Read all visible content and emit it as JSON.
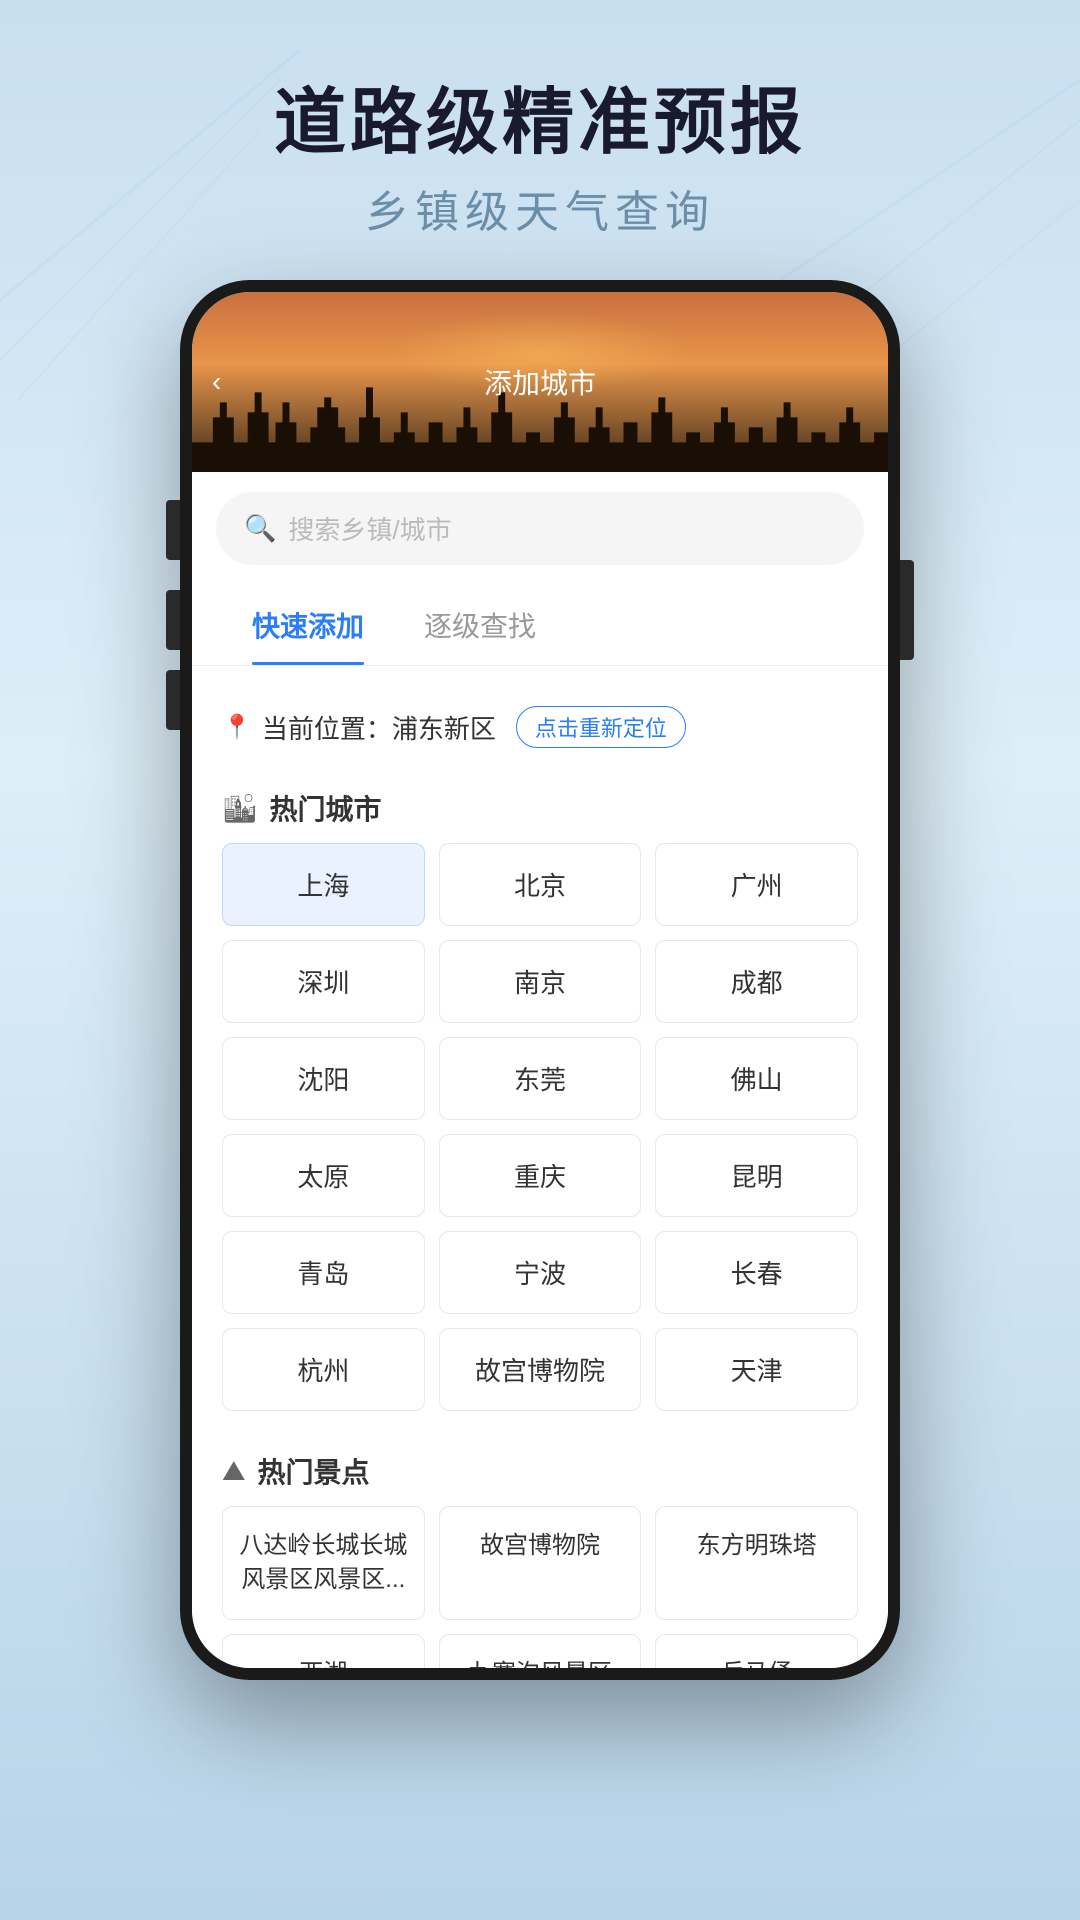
{
  "page": {
    "background": "#c8dff0"
  },
  "hero": {
    "title": "道路级精准预报",
    "subtitle": "乡镇级天气查询"
  },
  "app": {
    "header": {
      "back_label": "‹",
      "title": "添加城市"
    },
    "search": {
      "placeholder": "搜索乡镇/城市"
    },
    "tabs": [
      {
        "id": "quick",
        "label": "快速添加",
        "active": true
      },
      {
        "id": "browse",
        "label": "逐级查找",
        "active": false
      }
    ],
    "location": {
      "prefix": "当前位置：浦东新区",
      "badge": "点击重新定位"
    },
    "hot_cities": {
      "section_title": "热门城市",
      "cities": [
        {
          "name": "上海",
          "selected": true
        },
        {
          "name": "北京",
          "selected": false
        },
        {
          "name": "广州",
          "selected": false
        },
        {
          "name": "深圳",
          "selected": false
        },
        {
          "name": "南京",
          "selected": false
        },
        {
          "name": "成都",
          "selected": false
        },
        {
          "name": "沈阳",
          "selected": false
        },
        {
          "name": "东莞",
          "selected": false
        },
        {
          "name": "佛山",
          "selected": false
        },
        {
          "name": "太原",
          "selected": false
        },
        {
          "name": "重庆",
          "selected": false
        },
        {
          "name": "昆明",
          "selected": false
        },
        {
          "name": "青岛",
          "selected": false
        },
        {
          "name": "宁波",
          "selected": false
        },
        {
          "name": "长春",
          "selected": false
        },
        {
          "name": "杭州",
          "selected": false
        },
        {
          "name": "故宫博物院",
          "selected": false
        },
        {
          "name": "天津",
          "selected": false
        }
      ]
    },
    "hot_attractions": {
      "section_title": "热门景点",
      "attractions": [
        {
          "name": "八达岭长城长城\n风景区风景区..."
        },
        {
          "name": "故宫博物院"
        },
        {
          "name": "东方明珠塔"
        },
        {
          "name": "西湖"
        },
        {
          "name": "九寨沟风景区"
        },
        {
          "name": "兵马俑"
        }
      ]
    }
  }
}
